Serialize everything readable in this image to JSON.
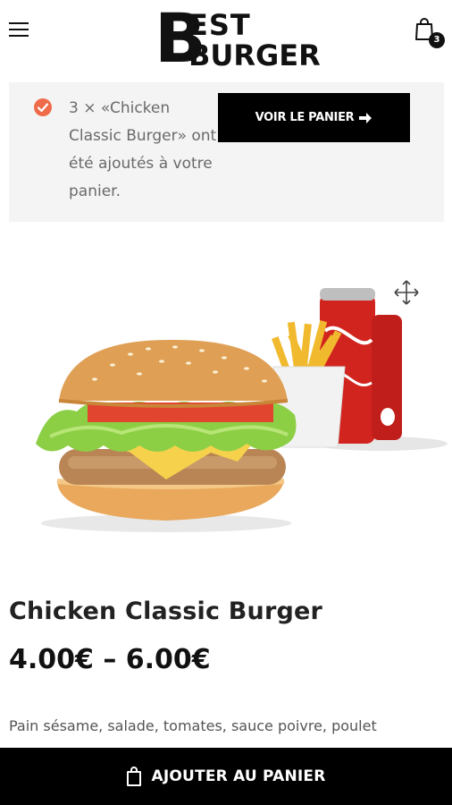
{
  "header": {
    "logo_letter": "B",
    "logo_line1": "EST",
    "logo_line2": "BURGER",
    "cart_count": "3"
  },
  "notice": {
    "message": "3 × «Chicken Classic Burger» ont été ajoutés à votre panier.",
    "view_cart_label": "VOIR LE PANIER"
  },
  "product": {
    "title": "Chicken Classic Burger",
    "price": "4.00€ – 6.00€",
    "description": "Pain sésame, salade, tomates, sauce poivre, poulet"
  },
  "footer": {
    "add_to_cart_label": "AJOUTER AU PANIER"
  },
  "colors": {
    "accent": "#ef6b4a",
    "dark": "#000000",
    "notice_bg": "#f4f4f4"
  },
  "icons": [
    "menu-icon",
    "cart-icon",
    "check-icon",
    "arrow-right-icon",
    "move-icon",
    "shopping-bag-icon"
  ]
}
